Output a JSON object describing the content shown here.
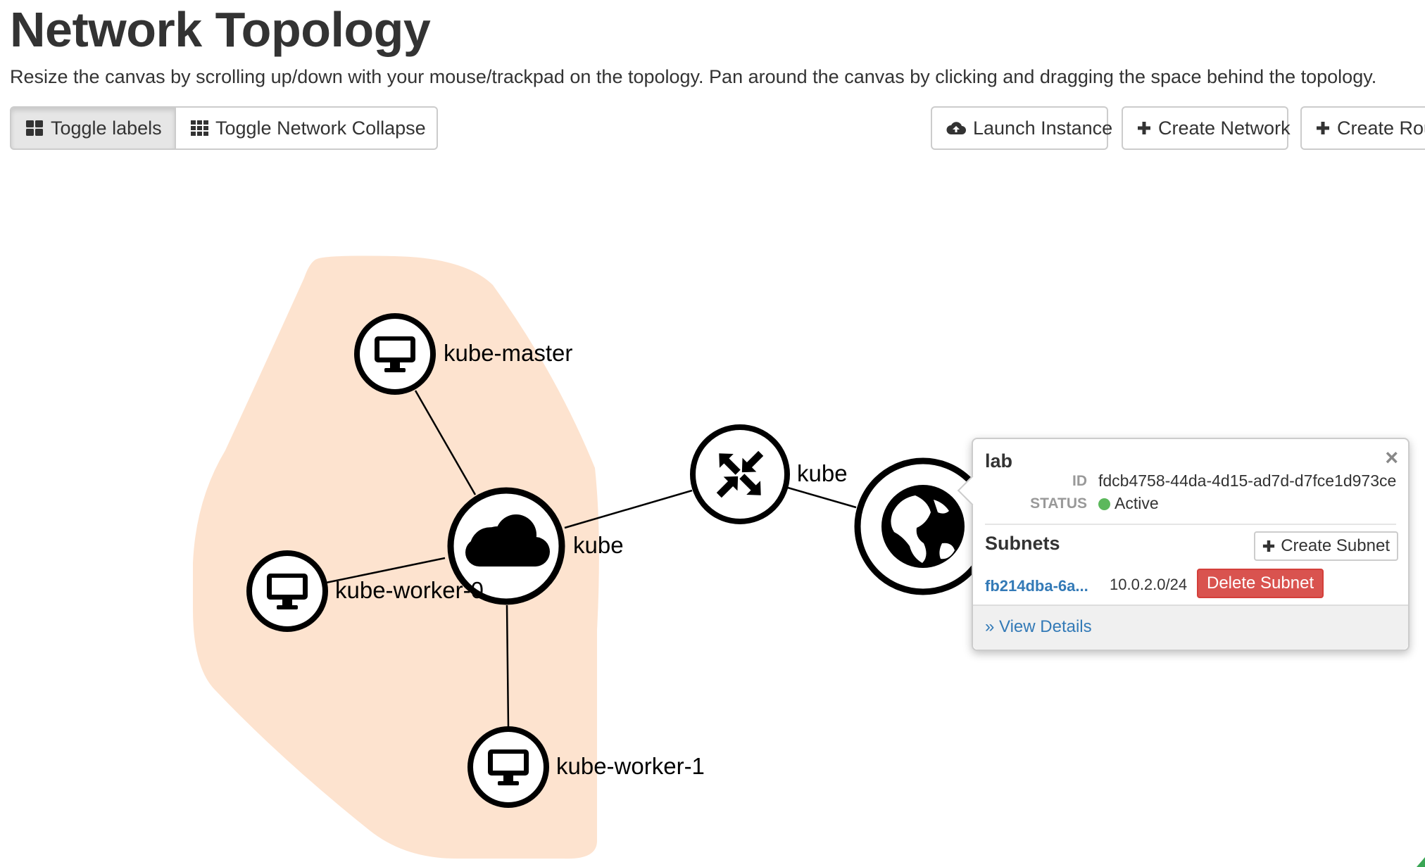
{
  "page": {
    "title": "Network Topology",
    "description": "Resize the canvas by scrolling up/down with your mouse/trackpad on the topology. Pan around the canvas by clicking and dragging the space behind the topology."
  },
  "toolbar": {
    "toggle_labels": "Toggle labels",
    "toggle_collapse": "Toggle Network Collapse",
    "launch_instance": "Launch Instance",
    "create_network": "Create Network",
    "create_router": "Create Router"
  },
  "topology": {
    "network_area_color": "#fde3cf",
    "network": {
      "label": "kube",
      "icon": "cloud-icon"
    },
    "instances": [
      {
        "label": "kube-master",
        "icon": "monitor-icon"
      },
      {
        "label": "kube-worker-0",
        "icon": "monitor-icon"
      },
      {
        "label": "kube-worker-1",
        "icon": "monitor-icon"
      }
    ],
    "router": {
      "label": "kube",
      "icon": "router-arrows-icon"
    },
    "external_network": {
      "icon": "globe-icon"
    }
  },
  "popup": {
    "name": "lab",
    "id_label": "ID",
    "id_value": "fdcb4758-44da-4d15-ad7d-d7fce1d973ce",
    "status_label": "STATUS",
    "status_value": "Active",
    "status_color": "#5cb85c",
    "subnets_heading": "Subnets",
    "create_subnet": "Create Subnet",
    "subnet": {
      "id": "fb214dba-6a...",
      "cidr": "10.0.2.0/24",
      "delete_label": "Delete Subnet"
    },
    "view_details": "» View Details"
  }
}
